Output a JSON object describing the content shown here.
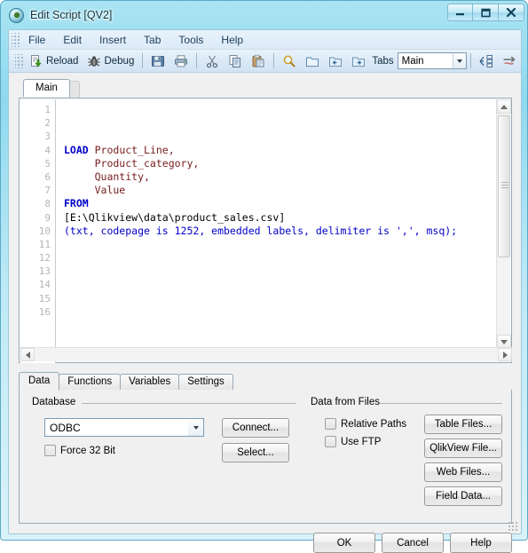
{
  "window": {
    "title": "Edit Script [QV2]",
    "app_icon": "qlikview-icon",
    "minimize": "minimize-icon",
    "maximize": "maximize-icon",
    "close": "close-icon"
  },
  "menubar": {
    "items": [
      {
        "label": "File"
      },
      {
        "label": "Edit"
      },
      {
        "label": "Insert"
      },
      {
        "label": "Tab"
      },
      {
        "label": "Tools"
      },
      {
        "label": "Help"
      }
    ]
  },
  "toolbar": {
    "reload_label": "Reload",
    "debug_label": "Debug",
    "save_icon": "save-icon",
    "print_icon": "print-icon",
    "cut_icon": "cut-icon",
    "copy_icon": "copy-icon",
    "paste_icon": "paste-icon",
    "find_icon": "search-icon",
    "open_icon": "folder-icon",
    "prev_tab_icon": "previous-tab-icon",
    "next_tab_icon": "next-tab-icon",
    "tabs_label": "Tabs",
    "tabs_value": "Main",
    "tabs_options": [
      "Main"
    ],
    "arrange_icon": "arrange-tabs-icon",
    "goto_icon": "goto-icon"
  },
  "editor": {
    "tab_label": "Main",
    "line_numbers": [
      "1",
      "2",
      "3",
      "4",
      "5",
      "6",
      "7",
      "8",
      "9",
      "10",
      "11",
      "12",
      "13",
      "14",
      "15",
      "16"
    ],
    "lines": [
      {
        "n": 1,
        "segments": []
      },
      {
        "n": 2,
        "segments": []
      },
      {
        "n": 3,
        "segments": []
      },
      {
        "n": 4,
        "segments": [
          {
            "t": "LOAD",
            "c": "kw"
          },
          {
            "t": " Product_Line,",
            "c": "fld"
          }
        ]
      },
      {
        "n": 5,
        "segments": [
          {
            "t": "     Product_category,",
            "c": "fld"
          }
        ]
      },
      {
        "n": 6,
        "segments": [
          {
            "t": "     Quantity,",
            "c": "fld"
          }
        ]
      },
      {
        "n": 7,
        "segments": [
          {
            "t": "     Value",
            "c": "fld"
          }
        ]
      },
      {
        "n": 8,
        "segments": [
          {
            "t": "FROM",
            "c": "kw"
          }
        ]
      },
      {
        "n": 9,
        "segments": [
          {
            "t": "[E:\\Qlikview\\data\\product_sales.csv]",
            "c": "pth"
          }
        ]
      },
      {
        "n": 10,
        "segments": [
          {
            "t": "(txt, codepage is 1252, embedded labels, delimiter is ',', msq);",
            "c": "opt"
          }
        ]
      },
      {
        "n": 11,
        "segments": []
      },
      {
        "n": 12,
        "segments": []
      },
      {
        "n": 13,
        "segments": []
      },
      {
        "n": 14,
        "segments": []
      },
      {
        "n": 15,
        "segments": []
      },
      {
        "n": 16,
        "segments": []
      }
    ]
  },
  "lower_tabs": [
    {
      "label": "Data",
      "active": true
    },
    {
      "label": "Functions",
      "active": false
    },
    {
      "label": "Variables",
      "active": false
    },
    {
      "label": "Settings",
      "active": false
    }
  ],
  "database_group": {
    "title": "Database",
    "combo_value": "ODBC",
    "combo_options": [
      "ODBC"
    ],
    "force32_label": "Force 32 Bit",
    "force32_checked": false,
    "connect_label": "Connect...",
    "select_label": "Select..."
  },
  "files_group": {
    "title": "Data from Files",
    "relative_paths_label": "Relative Paths",
    "relative_paths_checked": false,
    "use_ftp_label": "Use FTP",
    "use_ftp_checked": false,
    "table_files_label": "Table Files...",
    "qlikview_file_label": "QlikView File...",
    "web_files_label": "Web Files...",
    "field_data_label": "Field Data..."
  },
  "footer": {
    "ok_label": "OK",
    "cancel_label": "Cancel",
    "help_label": "Help"
  },
  "colors": {
    "frame": "#8fd9ef",
    "keyword": "#0000c8",
    "field": "#7a2020",
    "dialog_bg": "#f0f0f0"
  }
}
